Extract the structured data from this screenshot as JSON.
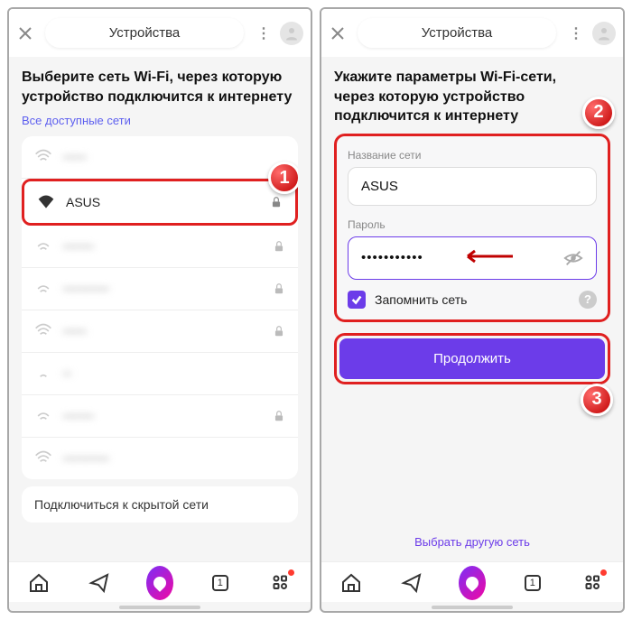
{
  "left": {
    "header_title": "Устройства",
    "heading": "Выберите сеть Wi-Fi, через которую устройство подключится к интернету",
    "all_networks_label": "Все доступные сети",
    "networks": [
      {
        "name": "",
        "signal": 3,
        "locked": false,
        "blurred": true
      },
      {
        "name": "ASUS",
        "signal": 4,
        "locked": true,
        "blurred": false,
        "highlighted": true
      },
      {
        "name": "",
        "signal": 2,
        "locked": true,
        "blurred": true
      },
      {
        "name": "",
        "signal": 2,
        "locked": true,
        "blurred": true
      },
      {
        "name": "",
        "signal": 3,
        "locked": true,
        "blurred": true
      },
      {
        "name": "",
        "signal": 1,
        "locked": false,
        "blurred": true
      },
      {
        "name": "",
        "signal": 2,
        "locked": true,
        "blurred": true
      },
      {
        "name": "",
        "signal": 3,
        "locked": false,
        "blurred": true
      }
    ],
    "hidden_network_link": "Подключиться к скрытой сети",
    "step_number": "1"
  },
  "right": {
    "header_title": "Устройства",
    "heading": "Укажите параметры Wi-Fi-сети, через которую устройство подключится к интернету",
    "ssid_label": "Название сети",
    "ssid_value": "ASUS",
    "password_label": "Пароль",
    "password_value": "•••••••••••",
    "remember_label": "Запомнить сеть",
    "continue_label": "Продолжить",
    "alt_network_link": "Выбрать другую сеть",
    "step_form": "2",
    "step_button": "3"
  },
  "nav": {
    "home": "home-icon",
    "send": "send-icon",
    "alice": "alice-icon",
    "tabs": "tabs-icon",
    "tabs_count": "1",
    "menu": "menu-icon"
  }
}
